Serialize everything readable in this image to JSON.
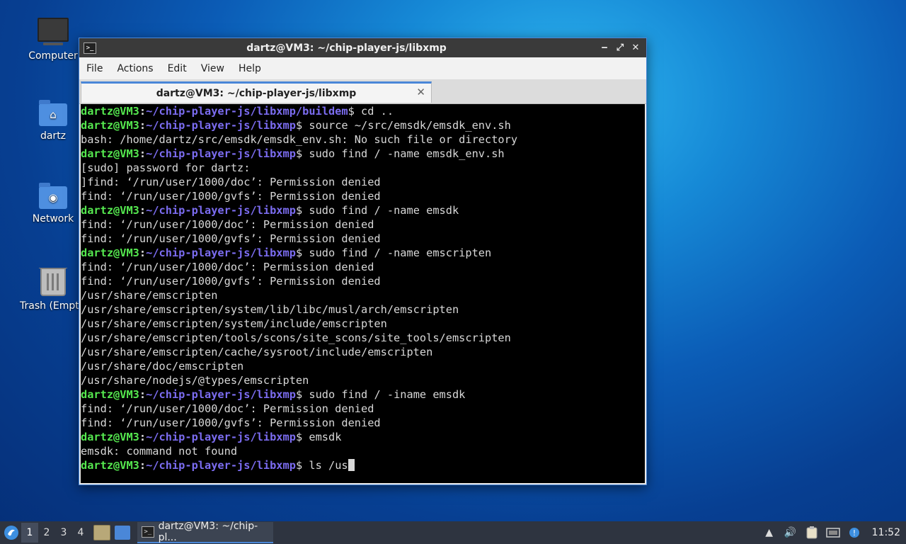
{
  "desktop": {
    "icons": [
      {
        "label": "Computer",
        "icon": "computer-icon"
      },
      {
        "label": "dartz",
        "icon": "home-folder-icon"
      },
      {
        "label": "Network",
        "icon": "network-folder-icon"
      },
      {
        "label": "Trash (Empty)",
        "icon": "trash-icon"
      }
    ]
  },
  "window": {
    "title": "dartz@VM3: ~/chip-player-js/libxmp",
    "controls": {
      "minimize": "‒",
      "maximize": "⤢",
      "close": "✕"
    },
    "menu": [
      "File",
      "Actions",
      "Edit",
      "View",
      "Help"
    ],
    "tab": {
      "label": "dartz@VM3: ~/chip-player-js/libxmp",
      "close": "✕"
    }
  },
  "terminal": {
    "lines": [
      {
        "user": "dartz@VM3",
        "path": "~/chip-player-js/libxmp/buildem",
        "cmd": "$ cd .."
      },
      {
        "user": "dartz@VM3",
        "path": "~/chip-player-js/libxmp",
        "cmd": "$ source ~/src/emsdk/emsdk_env.sh"
      },
      {
        "text": "bash: /home/dartz/src/emsdk/emsdk_env.sh: No such file or directory"
      },
      {
        "user": "dartz@VM3",
        "path": "~/chip-player-js/libxmp",
        "cmd": "$ sudo find / -name emsdk_env.sh"
      },
      {
        "text": "[sudo] password for dartz:"
      },
      {
        "text": "]find: ‘/run/user/1000/doc’: Permission denied"
      },
      {
        "text": "find: ‘/run/user/1000/gvfs’: Permission denied"
      },
      {
        "user": "dartz@VM3",
        "path": "~/chip-player-js/libxmp",
        "cmd": "$ sudo find / -name emsdk"
      },
      {
        "text": "find: ‘/run/user/1000/doc’: Permission denied"
      },
      {
        "text": "find: ‘/run/user/1000/gvfs’: Permission denied"
      },
      {
        "user": "dartz@VM3",
        "path": "~/chip-player-js/libxmp",
        "cmd": "$ sudo find / -name emscripten"
      },
      {
        "text": "find: ‘/run/user/1000/doc’: Permission denied"
      },
      {
        "text": "find: ‘/run/user/1000/gvfs’: Permission denied"
      },
      {
        "text": "/usr/share/emscripten"
      },
      {
        "text": "/usr/share/emscripten/system/lib/libc/musl/arch/emscripten"
      },
      {
        "text": "/usr/share/emscripten/system/include/emscripten"
      },
      {
        "text": "/usr/share/emscripten/tools/scons/site_scons/site_tools/emscripten"
      },
      {
        "text": "/usr/share/emscripten/cache/sysroot/include/emscripten"
      },
      {
        "text": "/usr/share/doc/emscripten"
      },
      {
        "text": "/usr/share/nodejs/@types/emscripten"
      },
      {
        "user": "dartz@VM3",
        "path": "~/chip-player-js/libxmp",
        "cmd": "$ sudo find / -iname emsdk"
      },
      {
        "text": "find: ‘/run/user/1000/doc’: Permission denied"
      },
      {
        "text": "find: ‘/run/user/1000/gvfs’: Permission denied"
      },
      {
        "user": "dartz@VM3",
        "path": "~/chip-player-js/libxmp",
        "cmd": "$ emsdk"
      },
      {
        "text": "emsdk: command not found"
      },
      {
        "user": "dartz@VM3",
        "path": "~/chip-player-js/libxmp",
        "cmd": "$ ls /us",
        "cursor": true
      }
    ]
  },
  "taskbar": {
    "workspaces": [
      "1",
      "2",
      "3",
      "4"
    ],
    "active_workspace": "1",
    "task_label": "dartz@VM3: ~/chip-pl...",
    "clock": "11:52"
  },
  "colors": {
    "prompt_user": "#55e84f",
    "prompt_path": "#7b6cf0",
    "accent": "#4a87d8"
  }
}
